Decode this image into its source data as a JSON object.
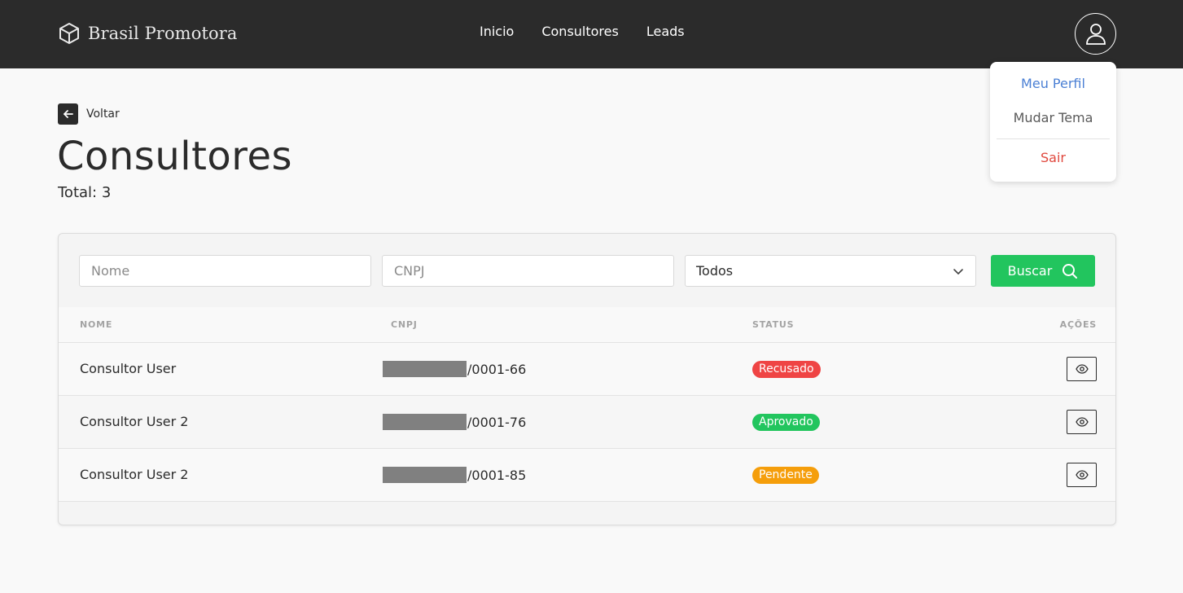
{
  "navbar": {
    "brand": "Brasil Promotora",
    "links": [
      "Inicio",
      "Consultores",
      "Leads"
    ]
  },
  "dropdown": {
    "profile": "Meu Perfil",
    "theme": "Mudar Tema",
    "logout": "Sair"
  },
  "page": {
    "back_label": "Voltar",
    "title": "Consultores",
    "total": "Total: 3"
  },
  "filters": {
    "name_placeholder": "Nome",
    "cnpj_placeholder": "CNPJ",
    "status_selected": "Todos",
    "search_label": "Buscar"
  },
  "table": {
    "headers": [
      "NOME",
      "CNPJ",
      "STATUS",
      "AÇÕES"
    ],
    "rows": [
      {
        "nome": "Consultor User",
        "cnpj_suffix": "/0001-66",
        "status": "Recusado",
        "status_color": "#ef4444"
      },
      {
        "nome": "Consultor User 2",
        "cnpj_suffix": "/0001-76",
        "status": "Aprovado",
        "status_color": "#22c55e"
      },
      {
        "nome": "Consultor User 2",
        "cnpj_suffix": "/0001-85",
        "status": "Pendente",
        "status_color": "#f59e0b"
      }
    ]
  },
  "colors": {
    "navbar": "#2b2b2b",
    "accent": "#22c55e",
    "link": "#4a7fd4",
    "danger": "#e0483e"
  },
  "icons": {
    "brand": "cube-icon",
    "user": "user-icon",
    "back": "arrow-left-icon",
    "select": "chevron-down-icon",
    "search": "search-icon",
    "view": "eye-icon"
  }
}
